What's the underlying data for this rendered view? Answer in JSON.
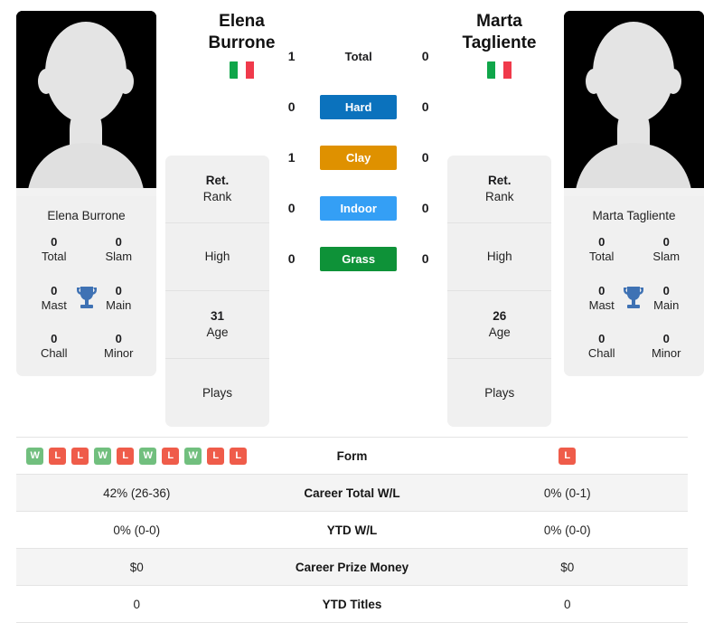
{
  "players": {
    "left": {
      "first_name": "Elena",
      "last_name": "Burrone",
      "full_name": "Elena Burrone",
      "country": "Italy",
      "flag_colors": [
        "#10a64a",
        "#ffffff",
        "#f03a4b"
      ],
      "titles": {
        "total": "0",
        "total_label": "Total",
        "slam": "0",
        "slam_label": "Slam",
        "mast": "0",
        "mast_label": "Mast",
        "main": "0",
        "main_label": "Main",
        "chall": "0",
        "chall_label": "Chall",
        "minor": "0",
        "minor_label": "Minor"
      },
      "info": {
        "rank_value": "Ret.",
        "rank_label": "Rank",
        "high_value": "",
        "high_label": "High",
        "age_value": "31",
        "age_label": "Age",
        "plays_value": "",
        "plays_label": "Plays"
      },
      "form": [
        "W",
        "L",
        "L",
        "W",
        "L",
        "W",
        "L",
        "W",
        "L",
        "L"
      ]
    },
    "right": {
      "first_name": "Marta",
      "last_name": "Tagliente",
      "full_name": "Marta Tagliente",
      "country": "Italy",
      "flag_colors": [
        "#10a64a",
        "#ffffff",
        "#f03a4b"
      ],
      "titles": {
        "total": "0",
        "total_label": "Total",
        "slam": "0",
        "slam_label": "Slam",
        "mast": "0",
        "mast_label": "Mast",
        "main": "0",
        "main_label": "Main",
        "chall": "0",
        "chall_label": "Chall",
        "minor": "0",
        "minor_label": "Minor"
      },
      "info": {
        "rank_value": "Ret.",
        "rank_label": "Rank",
        "high_value": "",
        "high_label": "High",
        "age_value": "26",
        "age_label": "Age",
        "plays_value": "",
        "plays_label": "Plays"
      },
      "form": [
        "L"
      ]
    }
  },
  "head_to_head": [
    {
      "label": "Total",
      "left": "1",
      "right": "0",
      "color": "",
      "styled": false
    },
    {
      "label": "Hard",
      "left": "0",
      "right": "0",
      "color": "#0b72bd",
      "styled": true
    },
    {
      "label": "Clay",
      "left": "1",
      "right": "0",
      "color": "#df9100",
      "styled": true
    },
    {
      "label": "Indoor",
      "left": "0",
      "right": "0",
      "color": "#349ff5",
      "styled": true
    },
    {
      "label": "Grass",
      "left": "0",
      "right": "0",
      "color": "#0e9238",
      "styled": true
    }
  ],
  "stats_rows": [
    {
      "label": "Form",
      "left": "",
      "right": "",
      "type": "form"
    },
    {
      "label": "Career Total W/L",
      "left": "42% (26-36)",
      "right": "0% (0-1)",
      "type": "text"
    },
    {
      "label": "YTD W/L",
      "left": "0% (0-0)",
      "right": "0% (0-0)",
      "type": "text"
    },
    {
      "label": "Career Prize Money",
      "left": "$0",
      "right": "$0",
      "type": "text"
    },
    {
      "label": "YTD Titles",
      "left": "0",
      "right": "0",
      "type": "text"
    }
  ],
  "colors": {
    "trophy": "#3f72b4",
    "win_badge": "#71bf7e",
    "loss_badge": "#ef5c4a",
    "card_background": "#f0f0f0",
    "avatar_background": "#000000"
  }
}
